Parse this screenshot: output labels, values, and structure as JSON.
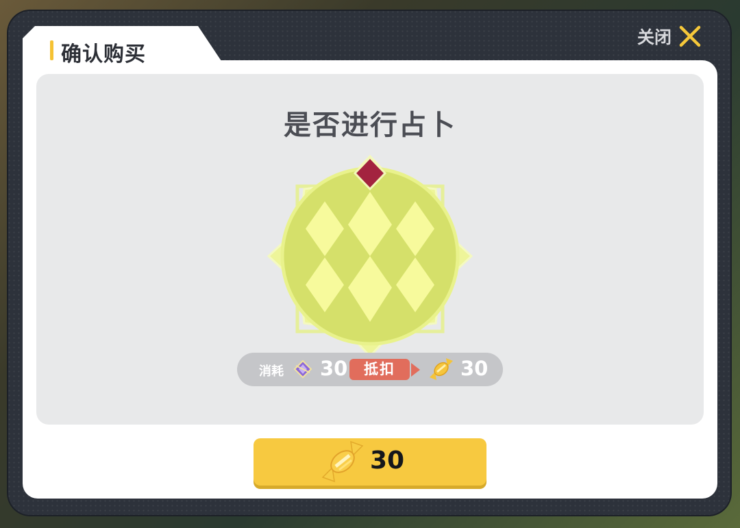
{
  "dialog": {
    "title": "确认购买",
    "close_label": "关闭",
    "prompt": "是否进行占卜"
  },
  "cost": {
    "label": "消耗",
    "gem_icon": "purple-crystal-icon",
    "gem_amount": "30",
    "deduct_label": "抵扣",
    "candy_icon": "candy-icon",
    "candy_amount": "30"
  },
  "purchase": {
    "candy_icon": "candy-icon",
    "price": "30"
  },
  "colors": {
    "accent_yellow": "#f7c940",
    "deduct_red": "#e16d5c",
    "emblem_green": "#d7e36a",
    "emblem_gem": "#a3233f"
  }
}
